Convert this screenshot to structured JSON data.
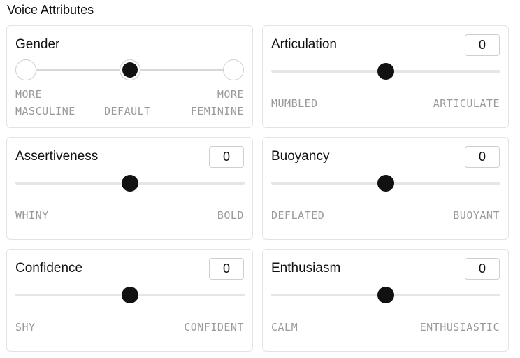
{
  "section_title": "Voice Attributes",
  "gender": {
    "title": "Gender",
    "options": [
      {
        "label_line1": "MORE",
        "label_line2": "MASCULINE"
      },
      {
        "label_line1": "",
        "label_line2": "DEFAULT"
      },
      {
        "label_line1": "MORE",
        "label_line2": "FEMININE"
      }
    ],
    "selected": "DEFAULT"
  },
  "sliders": [
    {
      "id": "articulation",
      "title": "Articulation",
      "value": "0",
      "left_label": "MUMBLED",
      "right_label": "ARTICULATE",
      "position": 0.5
    },
    {
      "id": "assertiveness",
      "title": "Assertiveness",
      "value": "0",
      "left_label": "WHINY",
      "right_label": "BOLD",
      "position": 0.5
    },
    {
      "id": "buoyancy",
      "title": "Buoyancy",
      "value": "0",
      "left_label": "DEFLATED",
      "right_label": "BUOYANT",
      "position": 0.5
    },
    {
      "id": "confidence",
      "title": "Confidence",
      "value": "0",
      "left_label": "SHY",
      "right_label": "CONFIDENT",
      "position": 0.5
    },
    {
      "id": "enthusiasm",
      "title": "Enthusiasm",
      "value": "0",
      "left_label": "CALM",
      "right_label": "ENTHUSIASTIC",
      "position": 0.5
    }
  ]
}
